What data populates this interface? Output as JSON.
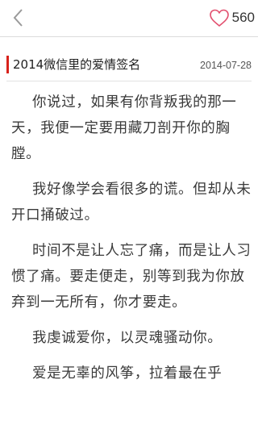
{
  "header": {
    "back_icon": "chevron-left-icon",
    "like_icon": "heart-outline-icon",
    "like_count": "560",
    "accent_color": "#e2506f"
  },
  "article": {
    "title": "2014微信里的爱情签名",
    "date": "2014-07-28",
    "accent_color": "#d8221b",
    "paragraphs": [
      "你说过，如果有你背叛我的那一天，我便一定要用藏刀剖开你的胸膛。",
      "我好像学会看很多的谎。但却从未开口捅破过。",
      "时间不是让人忘了痛，而是让人习惯了痛。要走便走，别等到我为你放弃到一无所有，你才要走。",
      "我虔诚爱你，以灵魂骚动你。",
      "爱是无辜的风筝，拉着最在乎"
    ]
  }
}
